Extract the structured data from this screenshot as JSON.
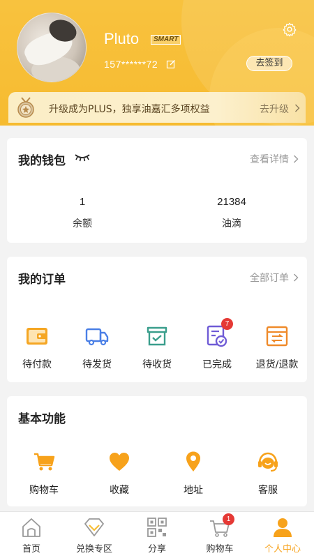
{
  "profile": {
    "username": "Pluto",
    "badge": "SMART",
    "phone": "157******72",
    "checkin_label": "去签到"
  },
  "plus": {
    "text": "升级成为PLUS，独享油嘉汇多项权益",
    "action": "去升级"
  },
  "wallet": {
    "title": "我的钱包",
    "link": "查看详情",
    "stats": [
      {
        "value": "1",
        "label": "余额"
      },
      {
        "value": "21384",
        "label": "油滴"
      }
    ]
  },
  "orders": {
    "title": "我的订单",
    "link": "全部订单",
    "items": [
      {
        "label": "待付款",
        "icon": "wallet-icon"
      },
      {
        "label": "待发货",
        "icon": "truck-icon"
      },
      {
        "label": "待收货",
        "icon": "box-icon"
      },
      {
        "label": "已完成",
        "icon": "completed-icon",
        "badge": "7"
      },
      {
        "label": "退货/退款",
        "icon": "return-icon"
      }
    ]
  },
  "functions": {
    "title": "基本功能",
    "items": [
      {
        "label": "购物车",
        "icon": "cart-icon"
      },
      {
        "label": "收藏",
        "icon": "heart-icon"
      },
      {
        "label": "地址",
        "icon": "location-icon"
      },
      {
        "label": "客服",
        "icon": "headset-icon"
      }
    ]
  },
  "tabbar": {
    "items": [
      {
        "label": "首页",
        "icon": "home-icon"
      },
      {
        "label": "兑换专区",
        "icon": "diamond-icon"
      },
      {
        "label": "分享",
        "icon": "qrcode-icon"
      },
      {
        "label": "购物车",
        "icon": "cart-icon",
        "badge": "1"
      },
      {
        "label": "个人中心",
        "icon": "user-icon"
      }
    ],
    "active_index": 4
  },
  "colors": {
    "header": "#f7be36",
    "accent": "#f7a21b",
    "badge_red": "#e53935",
    "order_icon_yellow": "#f5a623",
    "order_icon_blue": "#4a7fe6",
    "order_icon_teal": "#3a9e8c",
    "order_icon_purple": "#6f5bd6",
    "order_icon_orange": "#ef8a2a"
  }
}
